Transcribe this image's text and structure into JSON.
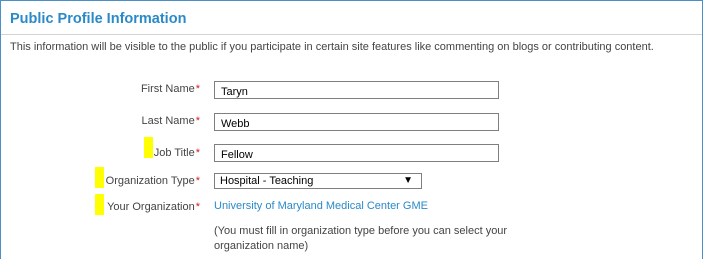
{
  "section": {
    "title": "Public Profile Information",
    "intro": "This information will be visible to the public if you participate in certain site features like commenting on blogs or contributing content."
  },
  "fields": {
    "first_name": {
      "label": "First Name",
      "value": "Taryn"
    },
    "last_name": {
      "label": "Last Name",
      "value": "Webb"
    },
    "job_title": {
      "label": "Job Title",
      "value": "Fellow"
    },
    "organization_type": {
      "label": "Organization Type",
      "value": "Hospital - Teaching"
    },
    "your_organization": {
      "label": "Your Organization",
      "value": "University of Maryland Medical Center GME"
    }
  },
  "required_marker": "*",
  "note": "(You must fill in organization type before you can select your organization name)",
  "colors": {
    "title": "#2a8ac9",
    "link": "#2a8ac9",
    "required": "#cc2222",
    "highlight": "#ffff00",
    "border": "#4a90c8"
  }
}
